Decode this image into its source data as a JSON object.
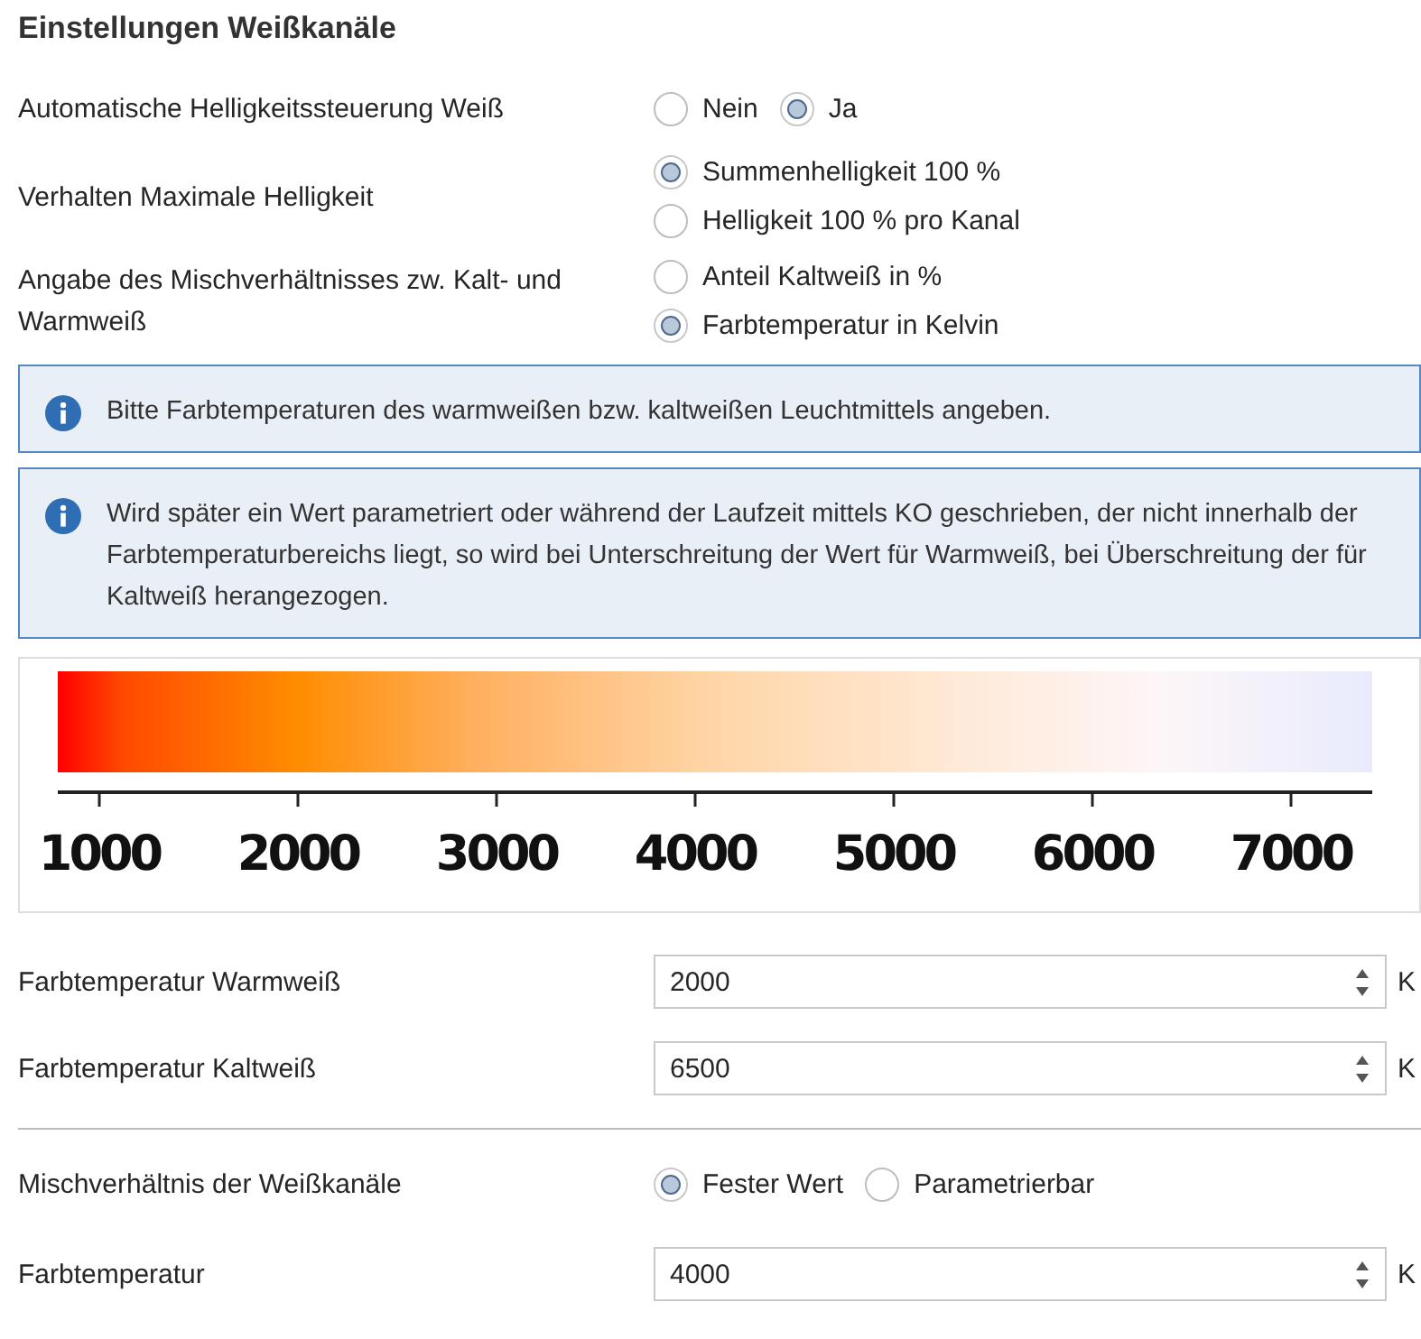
{
  "section_title": "Einstellungen Weißkanäle",
  "rows": [
    {
      "kind": "radio_row",
      "label": "Automatische Helligkeitssteuerung Weiß",
      "options": [
        {
          "label": "Nein",
          "selected": false
        },
        {
          "label": "Ja",
          "selected": true
        }
      ]
    },
    {
      "kind": "radio_column",
      "label": "Verhalten Maximale Helligkeit",
      "options": [
        {
          "label": "Summenhelligkeit 100 %",
          "selected": true
        },
        {
          "label": "Helligkeit 100 % pro Kanal",
          "selected": false
        }
      ]
    },
    {
      "kind": "radio_column",
      "label": "Angabe des Mischverhältnisses zw. Kalt- und Warmweiß",
      "options": [
        {
          "label": "Anteil Kaltweiß in %",
          "selected": false
        },
        {
          "label": "Farbtemperatur in Kelvin",
          "selected": true
        }
      ]
    },
    {
      "kind": "info",
      "text": "Bitte Farbtemperaturen des warmweißen bzw. kaltweißen Leuchtmittels angeben."
    },
    {
      "kind": "info",
      "text": "Wird später ein Wert parametriert oder während der Laufzeit mittels KO geschrieben, der nicht innerhalb der Farbtemperaturbereichs liegt, so wird bei Unterschreitung der Wert für Warmweiß, bei Überschreitung der für Kaltweiß herangezogen."
    },
    {
      "kind": "scale",
      "tick_labels": [
        "1000",
        "2000",
        "3000",
        "4000",
        "5000",
        "6000",
        "7000"
      ]
    },
    {
      "kind": "spin",
      "label": "Farbtemperatur Warmweiß",
      "value": "2000",
      "unit": "K"
    },
    {
      "kind": "spin",
      "label": "Farbtemperatur Kaltweiß",
      "value": "6500",
      "unit": "K"
    },
    {
      "kind": "divider"
    },
    {
      "kind": "radio_row",
      "label": "Mischverhältnis der Weißkanäle",
      "options": [
        {
          "label": "Fester Wert",
          "selected": true
        },
        {
          "label": "Parametrierbar",
          "selected": false
        }
      ]
    },
    {
      "kind": "spin",
      "label": "Farbtemperatur",
      "value": "4000",
      "unit": "K"
    }
  ]
}
